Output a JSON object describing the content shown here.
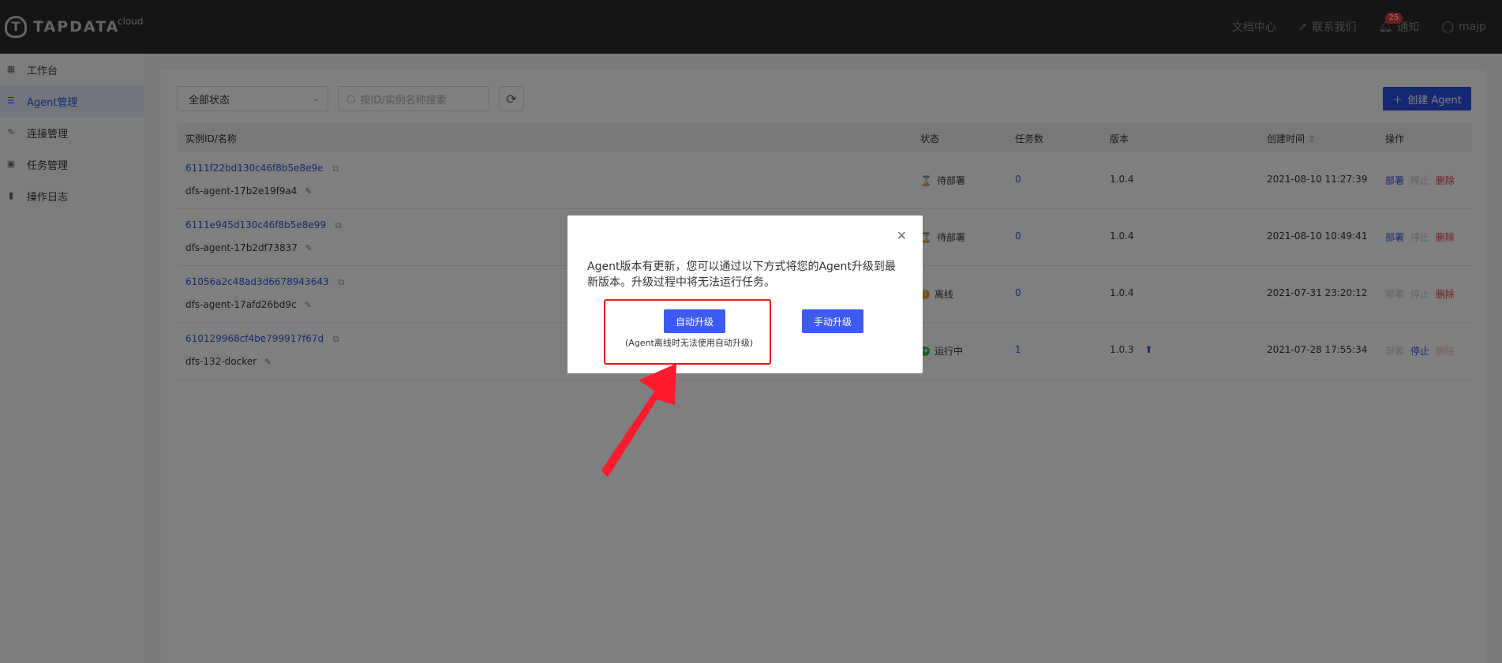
{
  "header": {
    "logo_text": "TAPDATA",
    "logo_sub": "cloud",
    "docs": "文档中心",
    "contact": "联系我们",
    "notify_count": "25",
    "notify": "通知",
    "user": "majp"
  },
  "sidebar": {
    "items": [
      {
        "label": "工作台",
        "icon": "dashboard-icon"
      },
      {
        "label": "Agent管理",
        "icon": "list-icon"
      },
      {
        "label": "连接管理",
        "icon": "link-icon"
      },
      {
        "label": "任务管理",
        "icon": "task-icon"
      },
      {
        "label": "操作日志",
        "icon": "log-icon"
      }
    ]
  },
  "toolbar": {
    "status_filter": "全部状态",
    "search_placeholder": "按ID/实例名称搜索",
    "create_label": "创建 Agent"
  },
  "table": {
    "headers": {
      "id": "实例ID/名称",
      "status": "状态",
      "tasks": "任务数",
      "version": "版本",
      "created": "创建时间",
      "ops": "操作"
    },
    "rows": [
      {
        "id": "6111f22bd130c46f8b5e8e9e",
        "name": "dfs-agent-17b2e19f9a4",
        "status": "待部署",
        "tasks": "0",
        "version": "1.0.4",
        "created": "2021-08-10 11:27:39",
        "deploy": "部署",
        "stop": "停止",
        "delete": "删除"
      },
      {
        "id": "6111e945d130c46f8b5e8e99",
        "name": "dfs-agent-17b2df73837",
        "status": "待部署",
        "tasks": "0",
        "version": "1.0.4",
        "created": "2021-08-10 10:49:41",
        "deploy": "部署",
        "stop": "停止",
        "delete": "删除"
      },
      {
        "id": "61056a2c48ad3d6678943643",
        "name": "dfs-agent-17afd26bd9c",
        "status": "离线",
        "tasks": "0",
        "version": "1.0.4",
        "created": "2021-07-31 23:20:12",
        "deploy": "部署",
        "stop": "停止",
        "delete": "删除"
      },
      {
        "id": "610129968cf4be799917f67d",
        "name": "dfs-132-docker",
        "status": "运行中",
        "tasks": "1",
        "version": "1.0.3",
        "created": "2021-07-28 17:55:34",
        "deploy": "部署",
        "stop": "停止",
        "delete": "删除"
      }
    ]
  },
  "modal": {
    "message": "Agent版本有更新，您可以通过以下方式将您的Agent升级到最新版本。升级过程中将无法运行任务。",
    "auto_upgrade": "自动升级",
    "manual_upgrade": "手动升级",
    "note": "(Agent离线时无法使用自动升级)"
  },
  "colors": {
    "accent": "#2b55d8",
    "danger": "#e4393c",
    "highlight": "#e4181e"
  }
}
